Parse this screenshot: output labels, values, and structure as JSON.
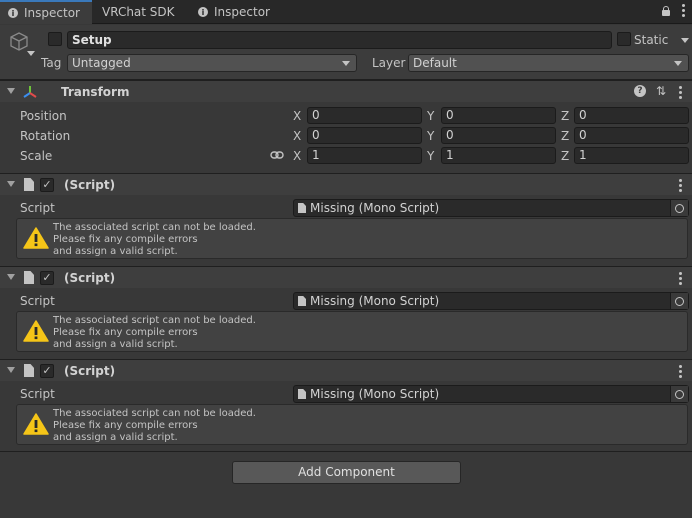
{
  "tabs": [
    {
      "label": "Inspector",
      "icon": "info-icon",
      "active": true
    },
    {
      "label": "VRChat SDK",
      "icon": "",
      "active": false
    },
    {
      "label": "Inspector",
      "icon": "info-icon",
      "active": false
    }
  ],
  "header": {
    "name": "Setup",
    "static_label": "Static",
    "tag_label": "Tag",
    "tag_value": "Untagged",
    "layer_label": "Layer",
    "layer_value": "Default"
  },
  "transform": {
    "title": "Transform",
    "rows": [
      {
        "label": "Position",
        "x": "0",
        "y": "0",
        "z": "0"
      },
      {
        "label": "Rotation",
        "x": "0",
        "y": "0",
        "z": "0"
      },
      {
        "label": "Scale",
        "x": "1",
        "y": "1",
        "z": "1"
      }
    ],
    "axes": [
      "X",
      "Y",
      "Z"
    ]
  },
  "scripts": [
    {
      "title": "(Script)",
      "field_label": "Script",
      "field_value": "Missing (Mono Script)",
      "help": [
        "The associated script can not be loaded.",
        "Please fix any compile errors",
        "and assign a valid script."
      ]
    },
    {
      "title": "(Script)",
      "field_label": "Script",
      "field_value": "Missing (Mono Script)",
      "help": [
        "The associated script can not be loaded.",
        "Please fix any compile errors",
        "and assign a valid script."
      ]
    },
    {
      "title": "(Script)",
      "field_label": "Script",
      "field_value": "Missing (Mono Script)",
      "help": [
        "The associated script can not be loaded.",
        "Please fix any compile errors",
        "and assign a valid script."
      ]
    }
  ],
  "add_component_label": "Add Component",
  "colors": {
    "accent": "#3a79bb",
    "warning": "#f5c518",
    "background": "#383838"
  }
}
